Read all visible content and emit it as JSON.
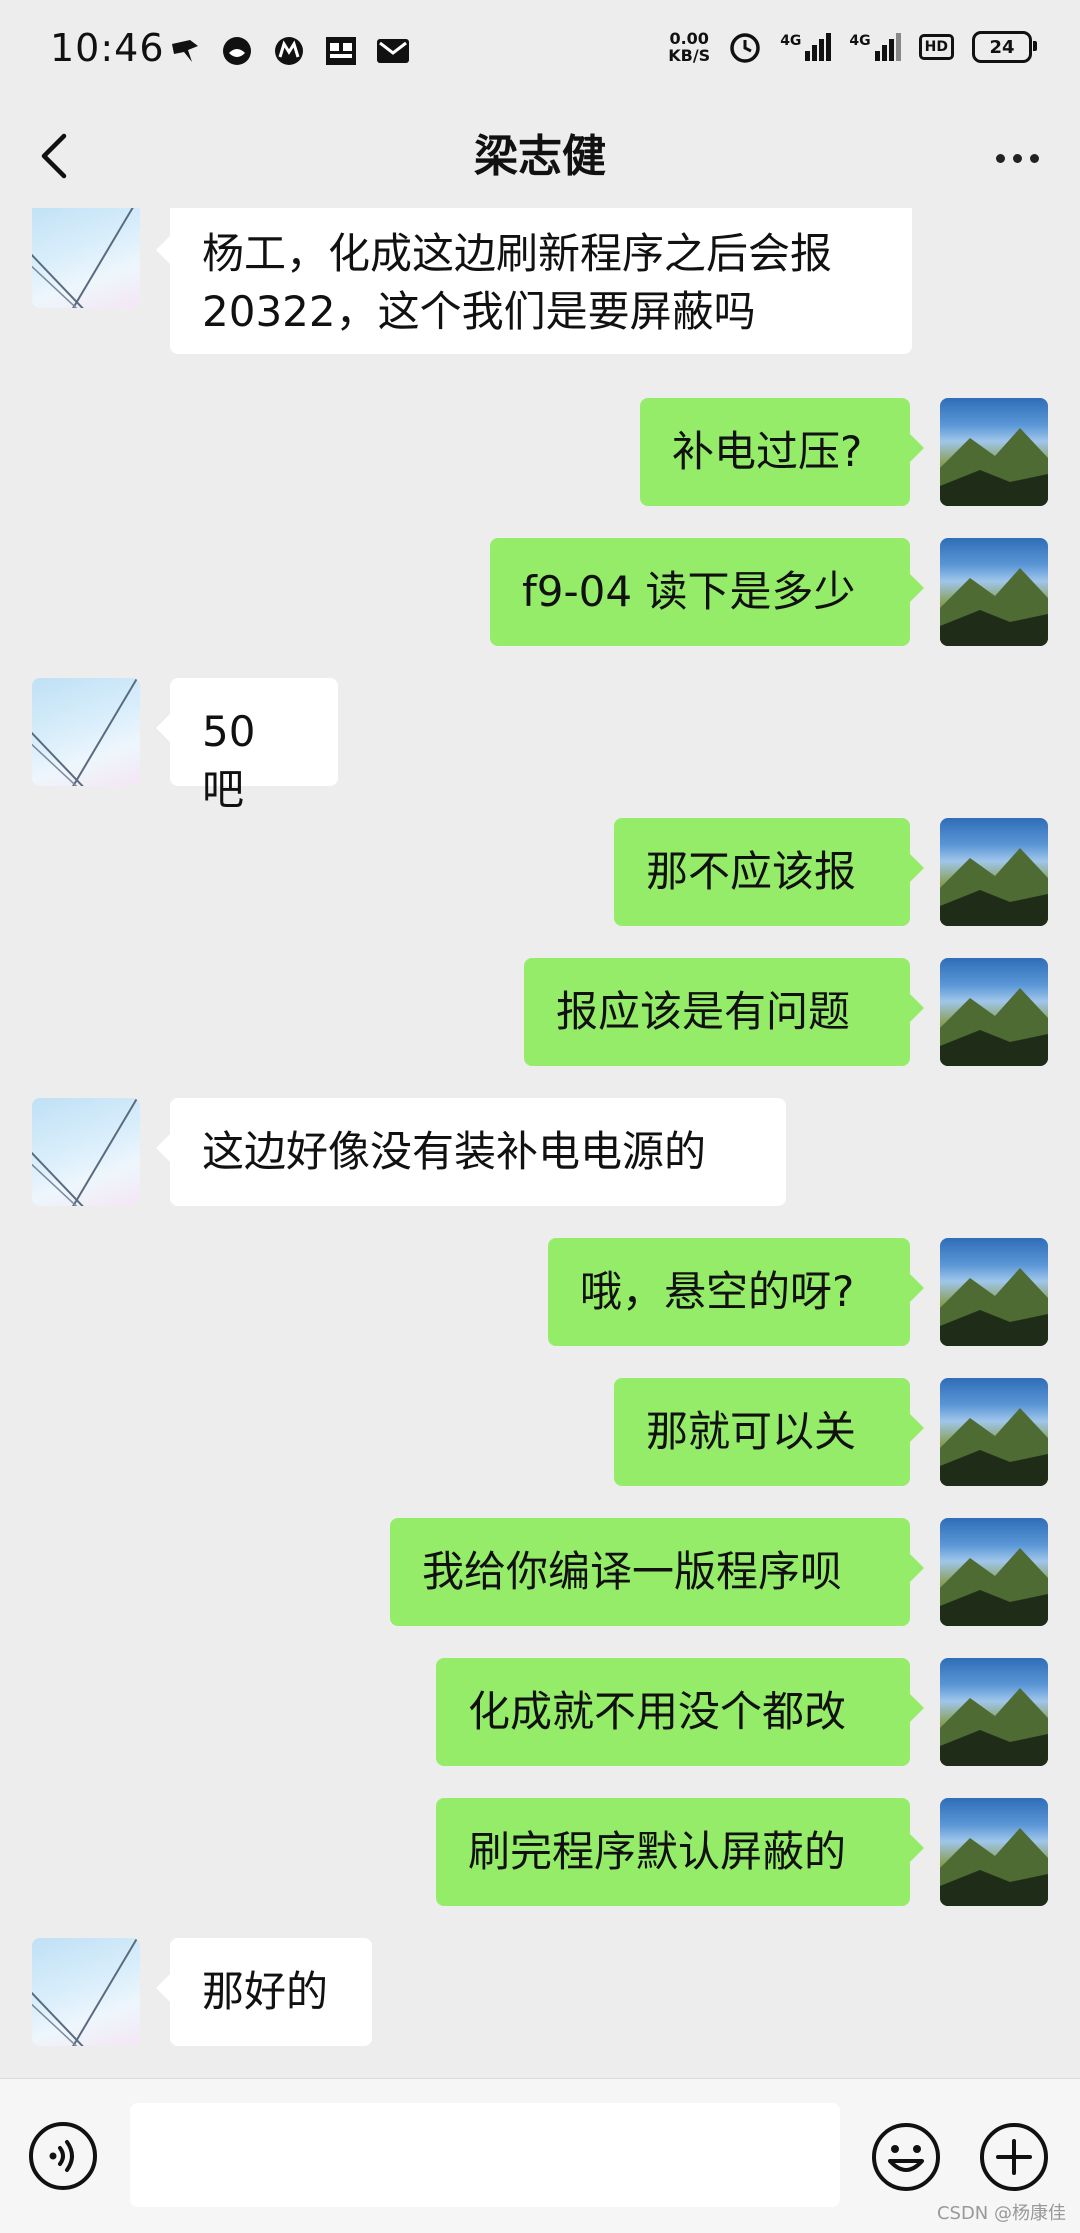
{
  "status_bar": {
    "time": "10:46",
    "speed_value": "0.00",
    "speed_unit": "KB/S",
    "net1": "4G",
    "net2": "4G",
    "hd": "HD",
    "battery": "24"
  },
  "header": {
    "title": "梁志健"
  },
  "messages": [
    {
      "side": "left",
      "text": "杨工，化成这边刷新程序之后会报20322，这个我们是要屏蔽吗"
    },
    {
      "side": "right",
      "text": "补电过压?"
    },
    {
      "side": "right",
      "text": "f9-04 读下是多少"
    },
    {
      "side": "left",
      "text": "50 吧"
    },
    {
      "side": "right",
      "text": "那不应该报"
    },
    {
      "side": "right",
      "text": "报应该是有问题"
    },
    {
      "side": "left",
      "text": "这边好像没有装补电电源的"
    },
    {
      "side": "right",
      "text": "哦，悬空的呀?"
    },
    {
      "side": "right",
      "text": "那就可以关"
    },
    {
      "side": "right",
      "text": "我给你编译一版程序呗"
    },
    {
      "side": "right",
      "text": "化成就不用没个都改"
    },
    {
      "side": "right",
      "text": "刷完程序默认屏蔽的"
    },
    {
      "side": "left",
      "text": "那好的"
    }
  ],
  "input": {
    "value": ""
  },
  "watermark": "CSDN @杨康佳"
}
